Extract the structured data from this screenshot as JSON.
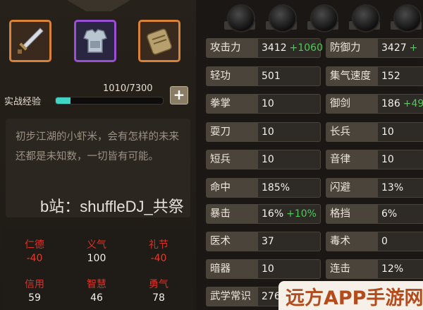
{
  "equipment": [
    {
      "slot": "weapon",
      "icon": "sword-icon",
      "rarity_color": "#d9823a"
    },
    {
      "slot": "armor",
      "icon": "armor-icon",
      "rarity_color": "#9a4fd4"
    },
    {
      "slot": "accessory",
      "icon": "pouch-icon",
      "rarity_color": "#d9823a"
    }
  ],
  "experience": {
    "label": "实战经验",
    "value_text": "1010/7300",
    "progress": 0.138,
    "plus_label": "+"
  },
  "description": "初步江湖的小虾米，会有怎样的未来还都是未知数，一切皆有可能。",
  "watermark": "b站：shuffleDJ_共祭",
  "virtues": [
    {
      "name": "仁德",
      "value": "-40"
    },
    {
      "name": "义气",
      "value": "100"
    },
    {
      "name": "礼节",
      "value": "-40"
    },
    {
      "name": "信用",
      "value": "59"
    },
    {
      "name": "智慧",
      "value": "46"
    },
    {
      "name": "勇气",
      "value": "78"
    }
  ],
  "stats_left": [
    {
      "label": "攻击力",
      "value": "3412",
      "bonus": "+1060"
    },
    {
      "label": "轻功",
      "value": "501",
      "bonus": ""
    },
    {
      "label": "拳掌",
      "value": "10",
      "bonus": ""
    },
    {
      "label": "耍刀",
      "value": "10",
      "bonus": ""
    },
    {
      "label": "短兵",
      "value": "10",
      "bonus": ""
    },
    {
      "label": "命中",
      "value": "185%",
      "bonus": ""
    },
    {
      "label": "暴击",
      "value": "16%",
      "bonus": "+10%"
    },
    {
      "label": "医术",
      "value": "37",
      "bonus": ""
    },
    {
      "label": "暗器",
      "value": "10",
      "bonus": ""
    },
    {
      "label": "武学常识",
      "value": "276",
      "bonus": ""
    }
  ],
  "stats_right": [
    {
      "label": "防御力",
      "value": "3427",
      "bonus": "+"
    },
    {
      "label": "集气速度",
      "value": "152",
      "bonus": ""
    },
    {
      "label": "御剑",
      "value": "186",
      "bonus": "+49"
    },
    {
      "label": "长兵",
      "value": "10",
      "bonus": ""
    },
    {
      "label": "音律",
      "value": "10",
      "bonus": ""
    },
    {
      "label": "闪避",
      "value": "13%",
      "bonus": ""
    },
    {
      "label": "格挡",
      "value": "6%",
      "bonus": ""
    },
    {
      "label": "毒术",
      "value": "0",
      "bonus": ""
    },
    {
      "label": "连击",
      "value": "12%",
      "bonus": ""
    },
    {
      "label": "",
      "value": "",
      "bonus": ""
    }
  ],
  "brand": "远方APP手游网",
  "colors": {
    "negative": "#e33a2c",
    "bonus": "#4ec95a",
    "xp_fill": "#3fd4c4"
  }
}
